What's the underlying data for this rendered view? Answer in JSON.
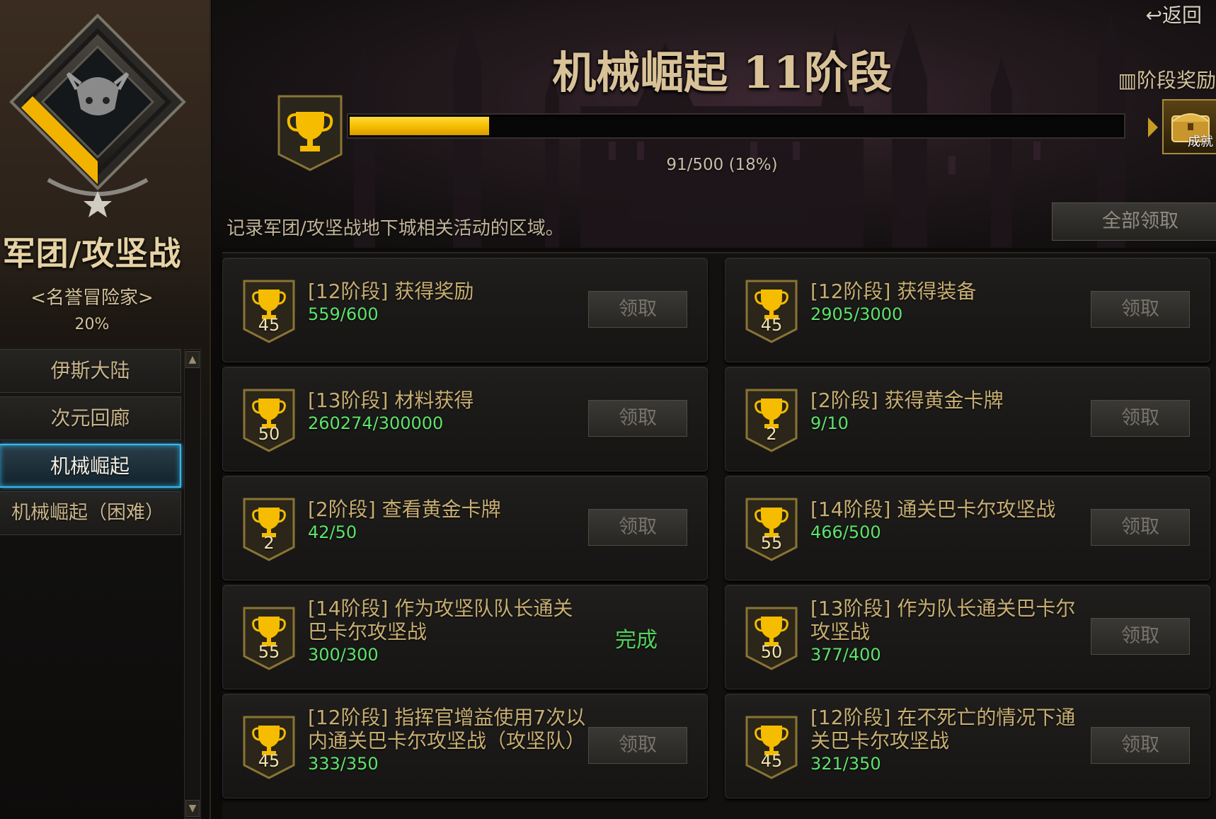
{
  "sidebar": {
    "category_title": "军团/攻坚战",
    "category_subtitle": "<名誉冒险家>",
    "category_percent": "20%",
    "nav_items": [
      {
        "label": "伊斯大陆",
        "active": false
      },
      {
        "label": "次元回廊",
        "active": false
      },
      {
        "label": "机械崛起",
        "active": true
      },
      {
        "label": "机械崛起（困难）",
        "active": false
      }
    ]
  },
  "header": {
    "return_label": "↩返回",
    "stage_title": "机械崛起 11阶段",
    "stage_reward_label": "阶段奖励",
    "stage_reward_icon_text": "成就",
    "progress_text": "91/500 (18%)",
    "progress_fraction": 0.18,
    "description": "记录军团/攻坚战地下城相关活动的区域。",
    "claim_all_label": "全部领取"
  },
  "colors": {
    "gold": "#f5bc00",
    "progress_green": "#5ee36a",
    "active_blue": "#3cb8e8"
  },
  "achievements": [
    {
      "points": "45",
      "title": "[12阶段] 获得奖励",
      "progress": "559/600",
      "action": "领取",
      "completed": false
    },
    {
      "points": "45",
      "title": "[12阶段] 获得装备",
      "progress": "2905/3000",
      "action": "领取",
      "completed": false
    },
    {
      "points": "50",
      "title": "[13阶段] 材料获得",
      "progress": "260274/300000",
      "action": "领取",
      "completed": false
    },
    {
      "points": "2",
      "title": "[2阶段] 获得黄金卡牌",
      "progress": "9/10",
      "action": "领取",
      "completed": false
    },
    {
      "points": "2",
      "title": "[2阶段] 查看黄金卡牌",
      "progress": "42/50",
      "action": "领取",
      "completed": false
    },
    {
      "points": "55",
      "title": "[14阶段] 通关巴卡尔攻坚战",
      "progress": "466/500",
      "action": "领取",
      "completed": false
    },
    {
      "points": "55",
      "title": "[14阶段] 作为攻坚队队长通关巴卡尔攻坚战",
      "progress": "300/300",
      "action": "完成",
      "completed": true
    },
    {
      "points": "50",
      "title": "[13阶段] 作为队长通关巴卡尔攻坚战",
      "progress": "377/400",
      "action": "领取",
      "completed": false
    },
    {
      "points": "45",
      "title": "[12阶段] 指挥官增益使用7次以内通关巴卡尔攻坚战（攻坚队）",
      "progress": "333/350",
      "action": "领取",
      "completed": false
    },
    {
      "points": "45",
      "title": "[12阶段] 在不死亡的情况下通关巴卡尔攻坚战",
      "progress": "321/350",
      "action": "领取",
      "completed": false
    }
  ]
}
